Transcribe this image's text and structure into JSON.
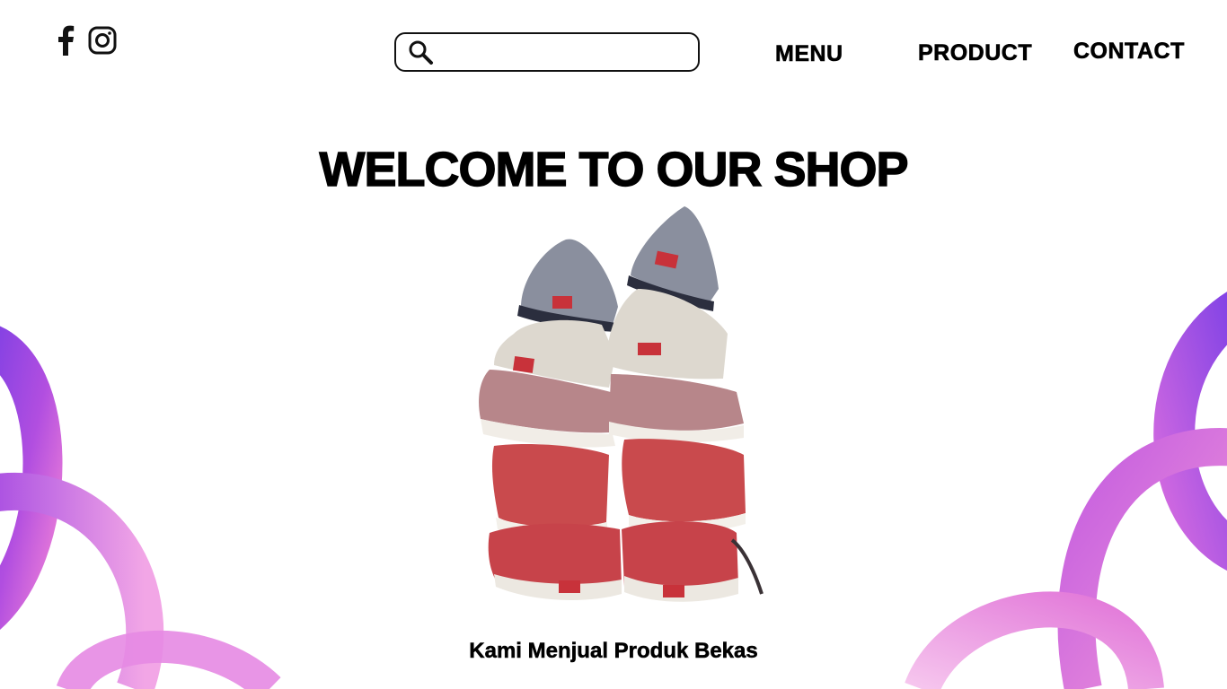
{
  "header": {
    "social": [
      {
        "name": "facebook",
        "icon": "facebook-icon"
      },
      {
        "name": "instagram",
        "icon": "instagram-icon"
      }
    ],
    "search": {
      "placeholder": "",
      "value": "",
      "icon": "search-icon"
    },
    "nav": {
      "menu": "MENU",
      "product": "PRODUCT",
      "contact": "CONTACT"
    }
  },
  "hero": {
    "title": "WELCOME TO OUR SHOP",
    "tagline": "Kami Menjual Produk Bekas"
  },
  "colors": {
    "text": "#000000",
    "background": "#ffffff",
    "accent_purple": "#8b3fe0",
    "accent_pink": "#f07ad8"
  }
}
